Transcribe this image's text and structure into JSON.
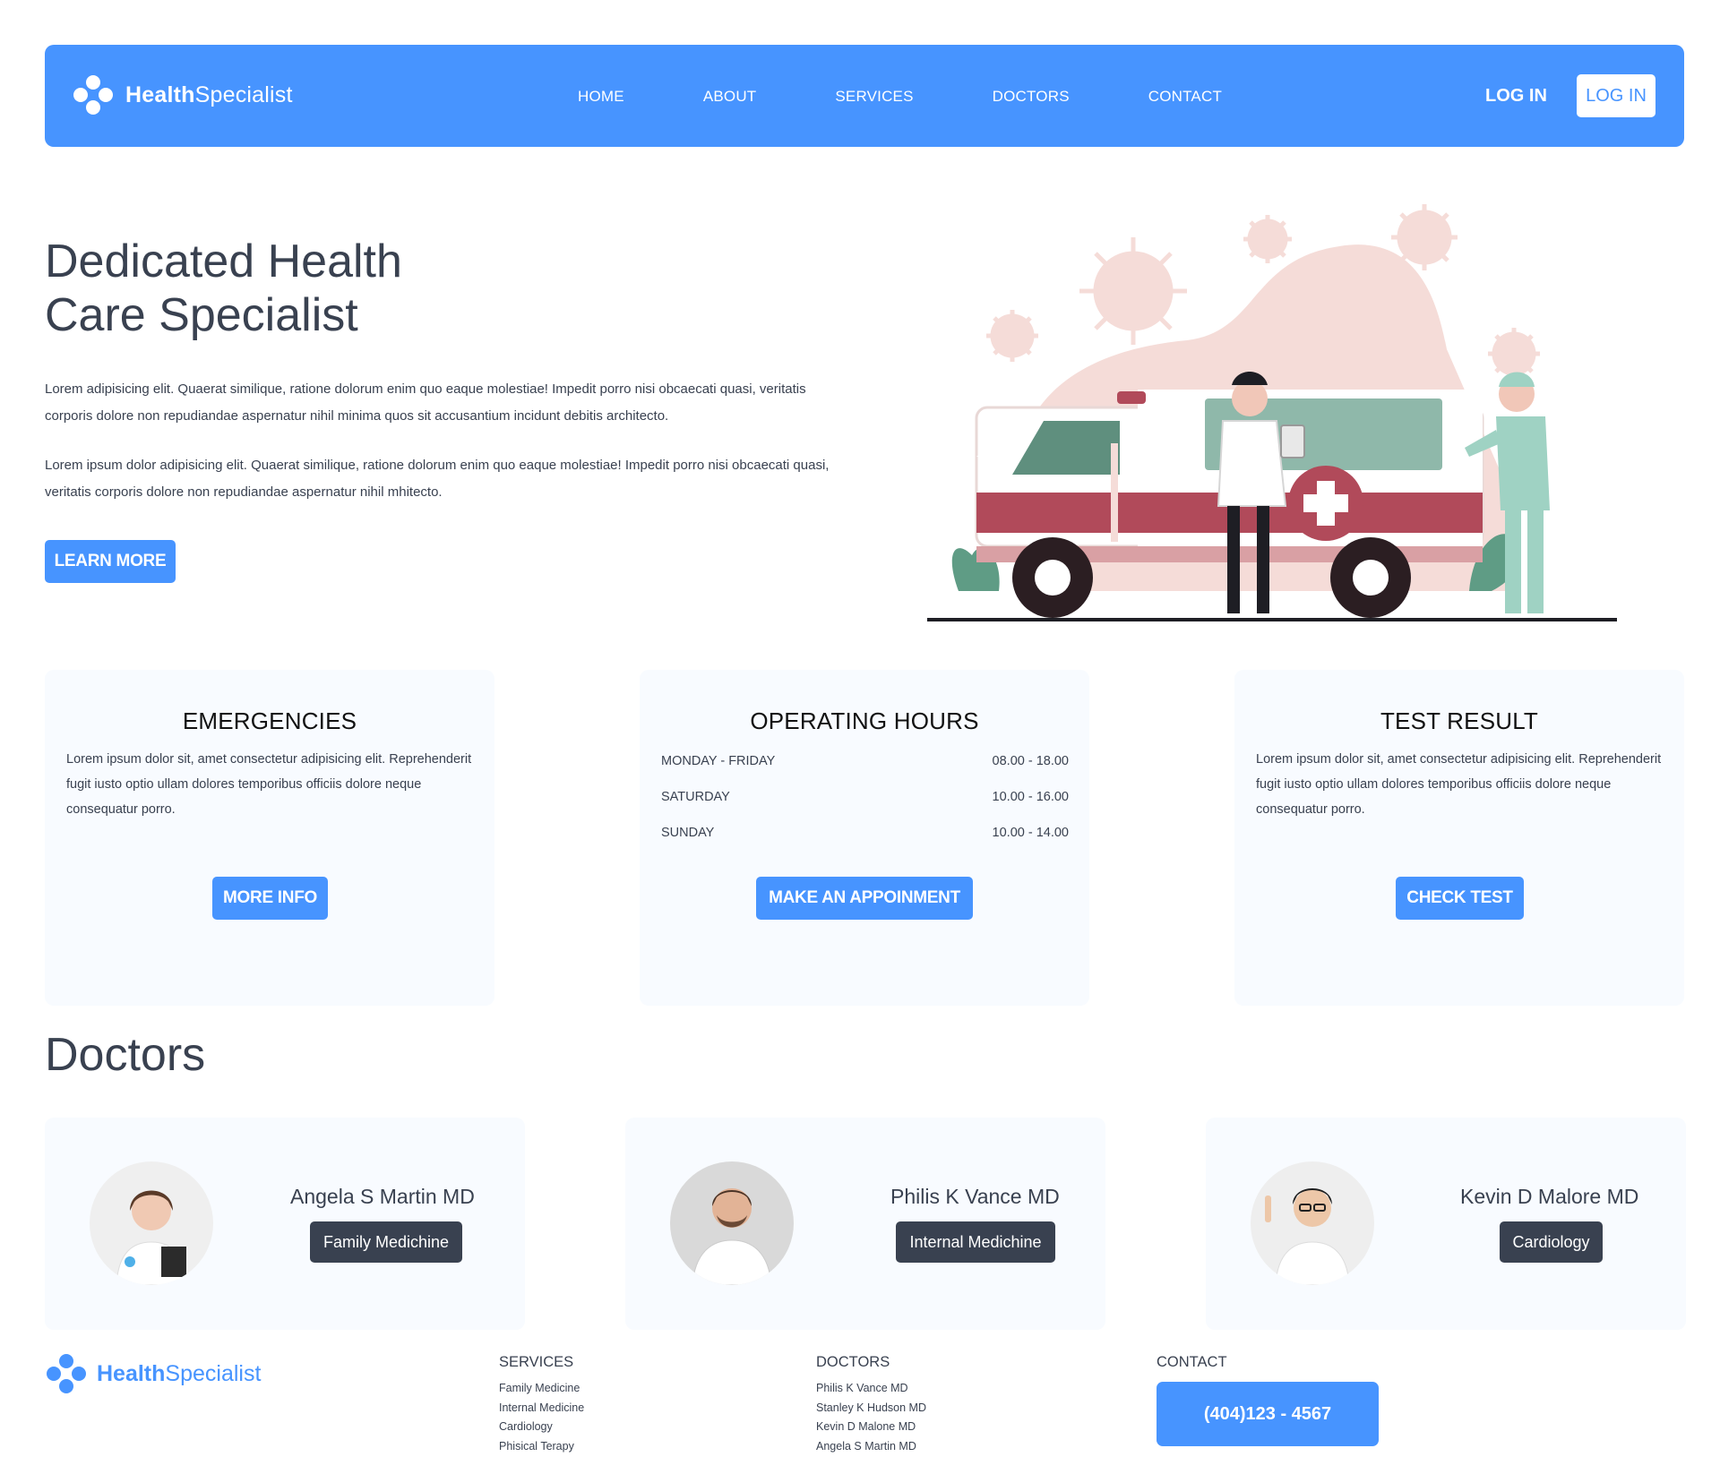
{
  "header": {
    "logo_bold": "Health",
    "logo_light": "Specialist",
    "nav": [
      "HOME",
      "ABOUT",
      "SERVICES",
      "DOCTORS",
      "CONTACT"
    ],
    "login_link": "LOG IN",
    "login_button": "LOG IN"
  },
  "hero": {
    "title_line1": "Dedicated Health",
    "title_line2": "Care Specialist",
    "paragraph1": "Lorem adipisicing elit. Quaerat similique, ratione dolorum enim quo eaque molestiae! Impedit porro nisi obcaecati quasi, veritatis corporis dolore non repudiandae aspernatur nihil minima quos sit accusantium incidunt debitis architecto.",
    "paragraph2": "Lorem ipsum dolor adipisicing elit. Quaerat similique, ratione dolorum enim quo eaque molestiae! Impedit porro nisi obcaecati quasi, veritatis corporis dolore non repudiandae aspernatur nihil mhitecto.",
    "cta": "LEARN MORE"
  },
  "cards": {
    "emergencies": {
      "title": "EMERGENCIES",
      "text": "Lorem ipsum dolor sit, amet consectetur adipisicing elit. Reprehenderit fugit iusto optio ullam dolores temporibus officiis dolore neque consequatur porro.",
      "button": "MORE INFO"
    },
    "hours": {
      "title": "OPERATING HOURS",
      "rows": [
        {
          "day": "MONDAY - FRIDAY",
          "time": "08.00 - 18.00"
        },
        {
          "day": "SATURDAY",
          "time": "10.00 - 16.00"
        },
        {
          "day": "SUNDAY",
          "time": "10.00 - 14.00"
        }
      ],
      "button": "MAKE AN APPOINMENT"
    },
    "test": {
      "title": "TEST RESULT",
      "text": "Lorem ipsum dolor sit, amet consectetur adipisicing elit. Reprehenderit fugit iusto optio ullam dolores temporibus officiis dolore neque consequatur porro.",
      "button": "CHECK TEST"
    }
  },
  "doctors": {
    "title": "Doctors",
    "list": [
      {
        "name": "Angela S Martin MD",
        "specialty": "Family Medichine"
      },
      {
        "name": "Philis K Vance MD",
        "specialty": "Internal Medichine"
      },
      {
        "name": "Kevin D Malore MD",
        "specialty": "Cardiology"
      }
    ]
  },
  "footer": {
    "services_title": "SERVICES",
    "services": [
      "Family Medicine",
      "Internal Medicine",
      "Cardiology",
      "Phisical Terapy"
    ],
    "doctors_title": "DOCTORS",
    "doctors": [
      "Philis K Vance MD",
      "Stanley K Hudson MD",
      "Kevin D Malone MD",
      "Angela S Martin MD"
    ],
    "contact_title": "CONTACT",
    "phone": "(404)123 - 4567"
  },
  "colors": {
    "brand_blue": "#4794ff",
    "dark": "#394150",
    "card_bg": "#f8fbff",
    "ambulance_red": "#b14a5a",
    "scrub_green": "#9fd2c3"
  }
}
